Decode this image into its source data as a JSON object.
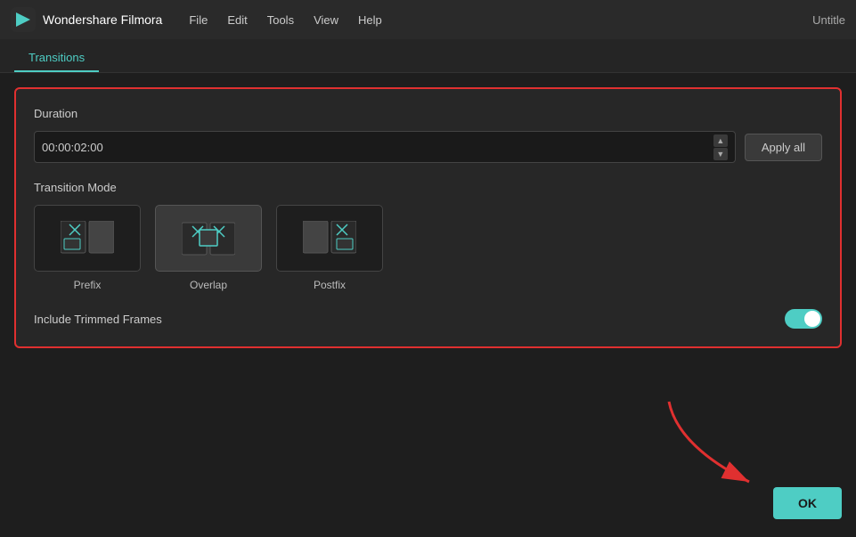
{
  "app": {
    "name": "Wondershare Filmora",
    "window_title": "Untitle"
  },
  "menu": {
    "items": [
      "File",
      "Edit",
      "Tools",
      "View",
      "Help"
    ]
  },
  "tabs": {
    "active": "Transitions"
  },
  "settings_panel": {
    "duration_label": "Duration",
    "duration_value": "00:00:02:00",
    "apply_all_label": "Apply all",
    "transition_mode_label": "Transition Mode",
    "modes": [
      {
        "id": "prefix",
        "label": "Prefix",
        "selected": false
      },
      {
        "id": "overlap",
        "label": "Overlap",
        "selected": true
      },
      {
        "id": "postfix",
        "label": "Postfix",
        "selected": false
      }
    ],
    "trimmed_frames_label": "Include Trimmed Frames",
    "toggle_on": true
  },
  "footer": {
    "ok_label": "OK"
  }
}
